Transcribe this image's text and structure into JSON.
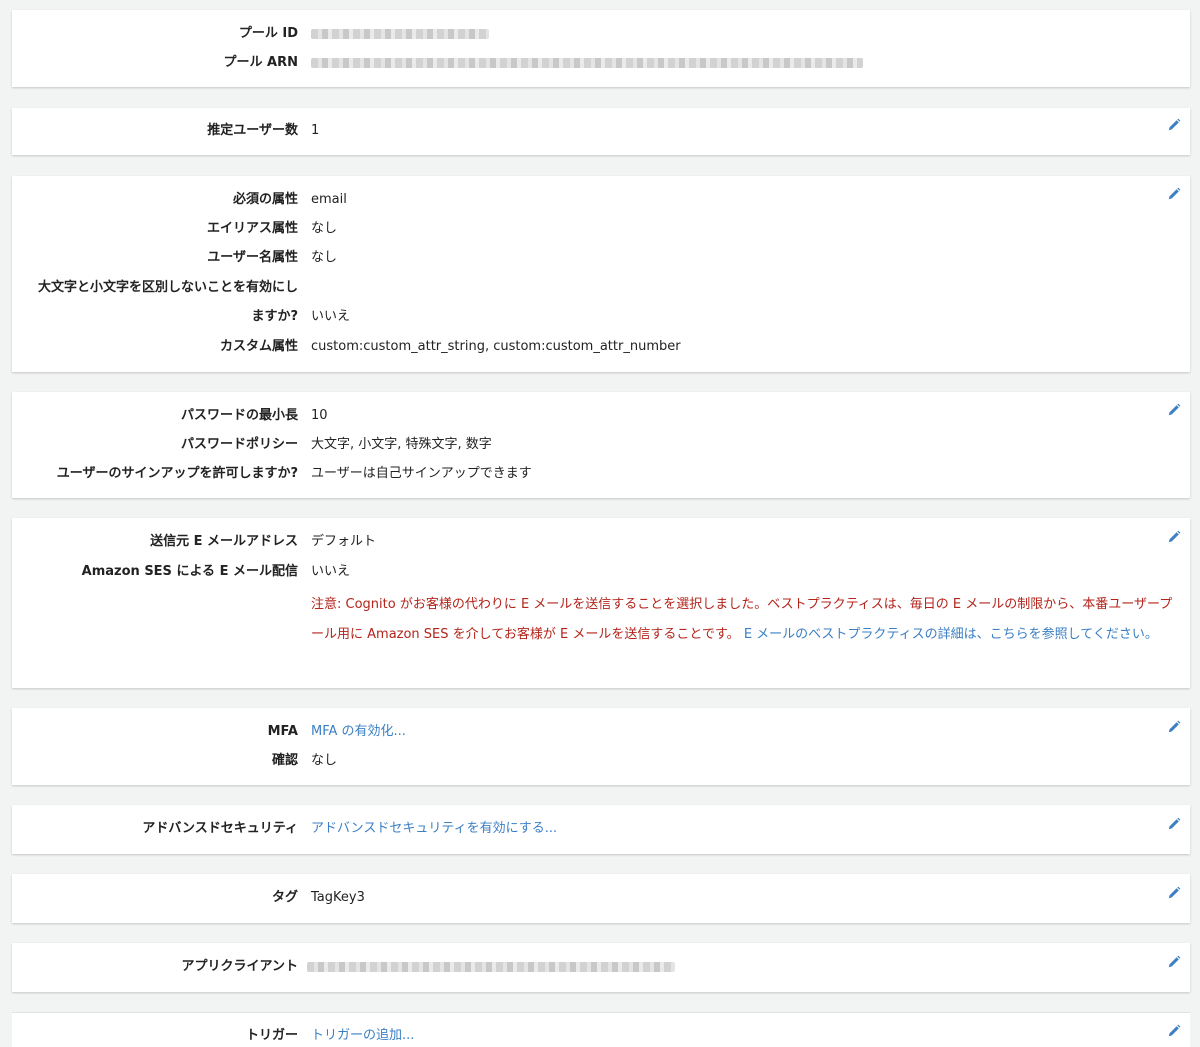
{
  "icons": {
    "edit": "pencil-icon",
    "redacted": "redacted-value-icon"
  },
  "colors": {
    "link": "#3b7fc4",
    "warning": "#b3241b",
    "background": "#f2f3f3",
    "card": "#ffffff"
  },
  "pool": {
    "id_label": "プール ID",
    "arn_label": "プール ARN"
  },
  "users": {
    "estimated_label": "推定ユーザー数",
    "estimated_value": "1"
  },
  "attributes": {
    "required_label": "必須の属性",
    "required_value": "email",
    "alias_label": "エイリアス属性",
    "alias_value": "なし",
    "username_label": "ユーザー名属性",
    "username_value": "なし",
    "case_label_line1": "大文字と小文字を区別しないことを有効にし",
    "case_label_line2": "ますか?",
    "case_value": "いいえ",
    "custom_label": "カスタム属性",
    "custom_value": "custom:custom_attr_string, custom:custom_attr_number"
  },
  "password": {
    "min_length_label": "パスワードの最小長",
    "min_length_value": "10",
    "policy_label": "パスワードポリシー",
    "policy_value": "大文字, 小文字, 特殊文字, 数字",
    "signup_label": "ユーザーのサインアップを許可しますか?",
    "signup_value": "ユーザーは自己サインアップできます"
  },
  "email": {
    "from_label": "送信元 E メールアドレス",
    "from_value": "デフォルト",
    "ses_label": "Amazon SES による E メール配信",
    "ses_value": "いいえ",
    "warning_text": "注意: Cognito がお客様の代わりに E メールを送信することを選択しました。ベストプラクティスは、毎日の E メールの制限から、本番ユーザープール用に Amazon SES を介してお客様が E メールを送信することです。",
    "best_practice_link": "E メールのベストプラクティスの詳細は、こちらを参照してください。"
  },
  "mfa": {
    "label": "MFA",
    "link": "MFA の有効化...",
    "verify_label": "確認",
    "verify_value": "なし"
  },
  "advanced_security": {
    "label": "アドバンスドセキュリティ",
    "link": "アドバンスドセキュリティを有効にする..."
  },
  "tags": {
    "label": "タグ",
    "value": "TagKey3"
  },
  "app_clients": {
    "label": "アプリクライアント"
  },
  "triggers": {
    "label": "トリガー",
    "link": "トリガーの追加..."
  }
}
